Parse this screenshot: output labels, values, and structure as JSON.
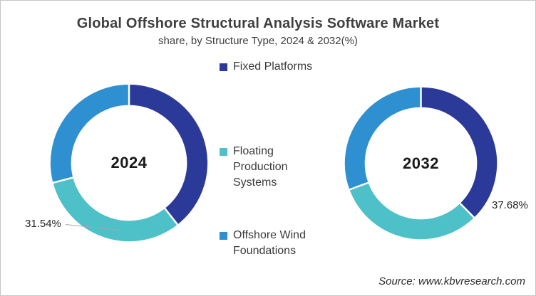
{
  "header": {
    "title": "Global Offshore Structural Analysis Software Market",
    "subtitle": "share, by Structure Type, 2024 & 2032(%)"
  },
  "legend": {
    "items": [
      {
        "label": "Fixed Platforms",
        "color": "#2B3A98"
      },
      {
        "label": "Floating Production Systems",
        "color": "#4EC0C8"
      },
      {
        "label": "Offshore Wind Foundations",
        "color": "#2E90D0"
      }
    ]
  },
  "chart_data": {
    "type": "pie",
    "variant": "donut",
    "title": "Global Offshore Structural Analysis Software Market share, by Structure Type, 2024 & 2032(%)",
    "categories": [
      "Fixed Platforms",
      "Floating Production Systems",
      "Offshore Wind Foundations"
    ],
    "colors": [
      "#2B3A98",
      "#4EC0C8",
      "#2E90D0"
    ],
    "donut_hole_ratio": 0.72,
    "start_angle_deg": 0,
    "direction": "clockwise",
    "legend_position": "center-column",
    "series": [
      {
        "name": "2024",
        "values": [
          39.4,
          31.54,
          29.06
        ],
        "data_labels": [
          "",
          "31.54%",
          ""
        ]
      },
      {
        "name": "2032",
        "values": [
          37.68,
          31.7,
          30.62
        ],
        "data_labels": [
          "37.68%",
          "",
          ""
        ]
      }
    ]
  },
  "source": {
    "text": "Source: www.kbvresearch.com"
  }
}
